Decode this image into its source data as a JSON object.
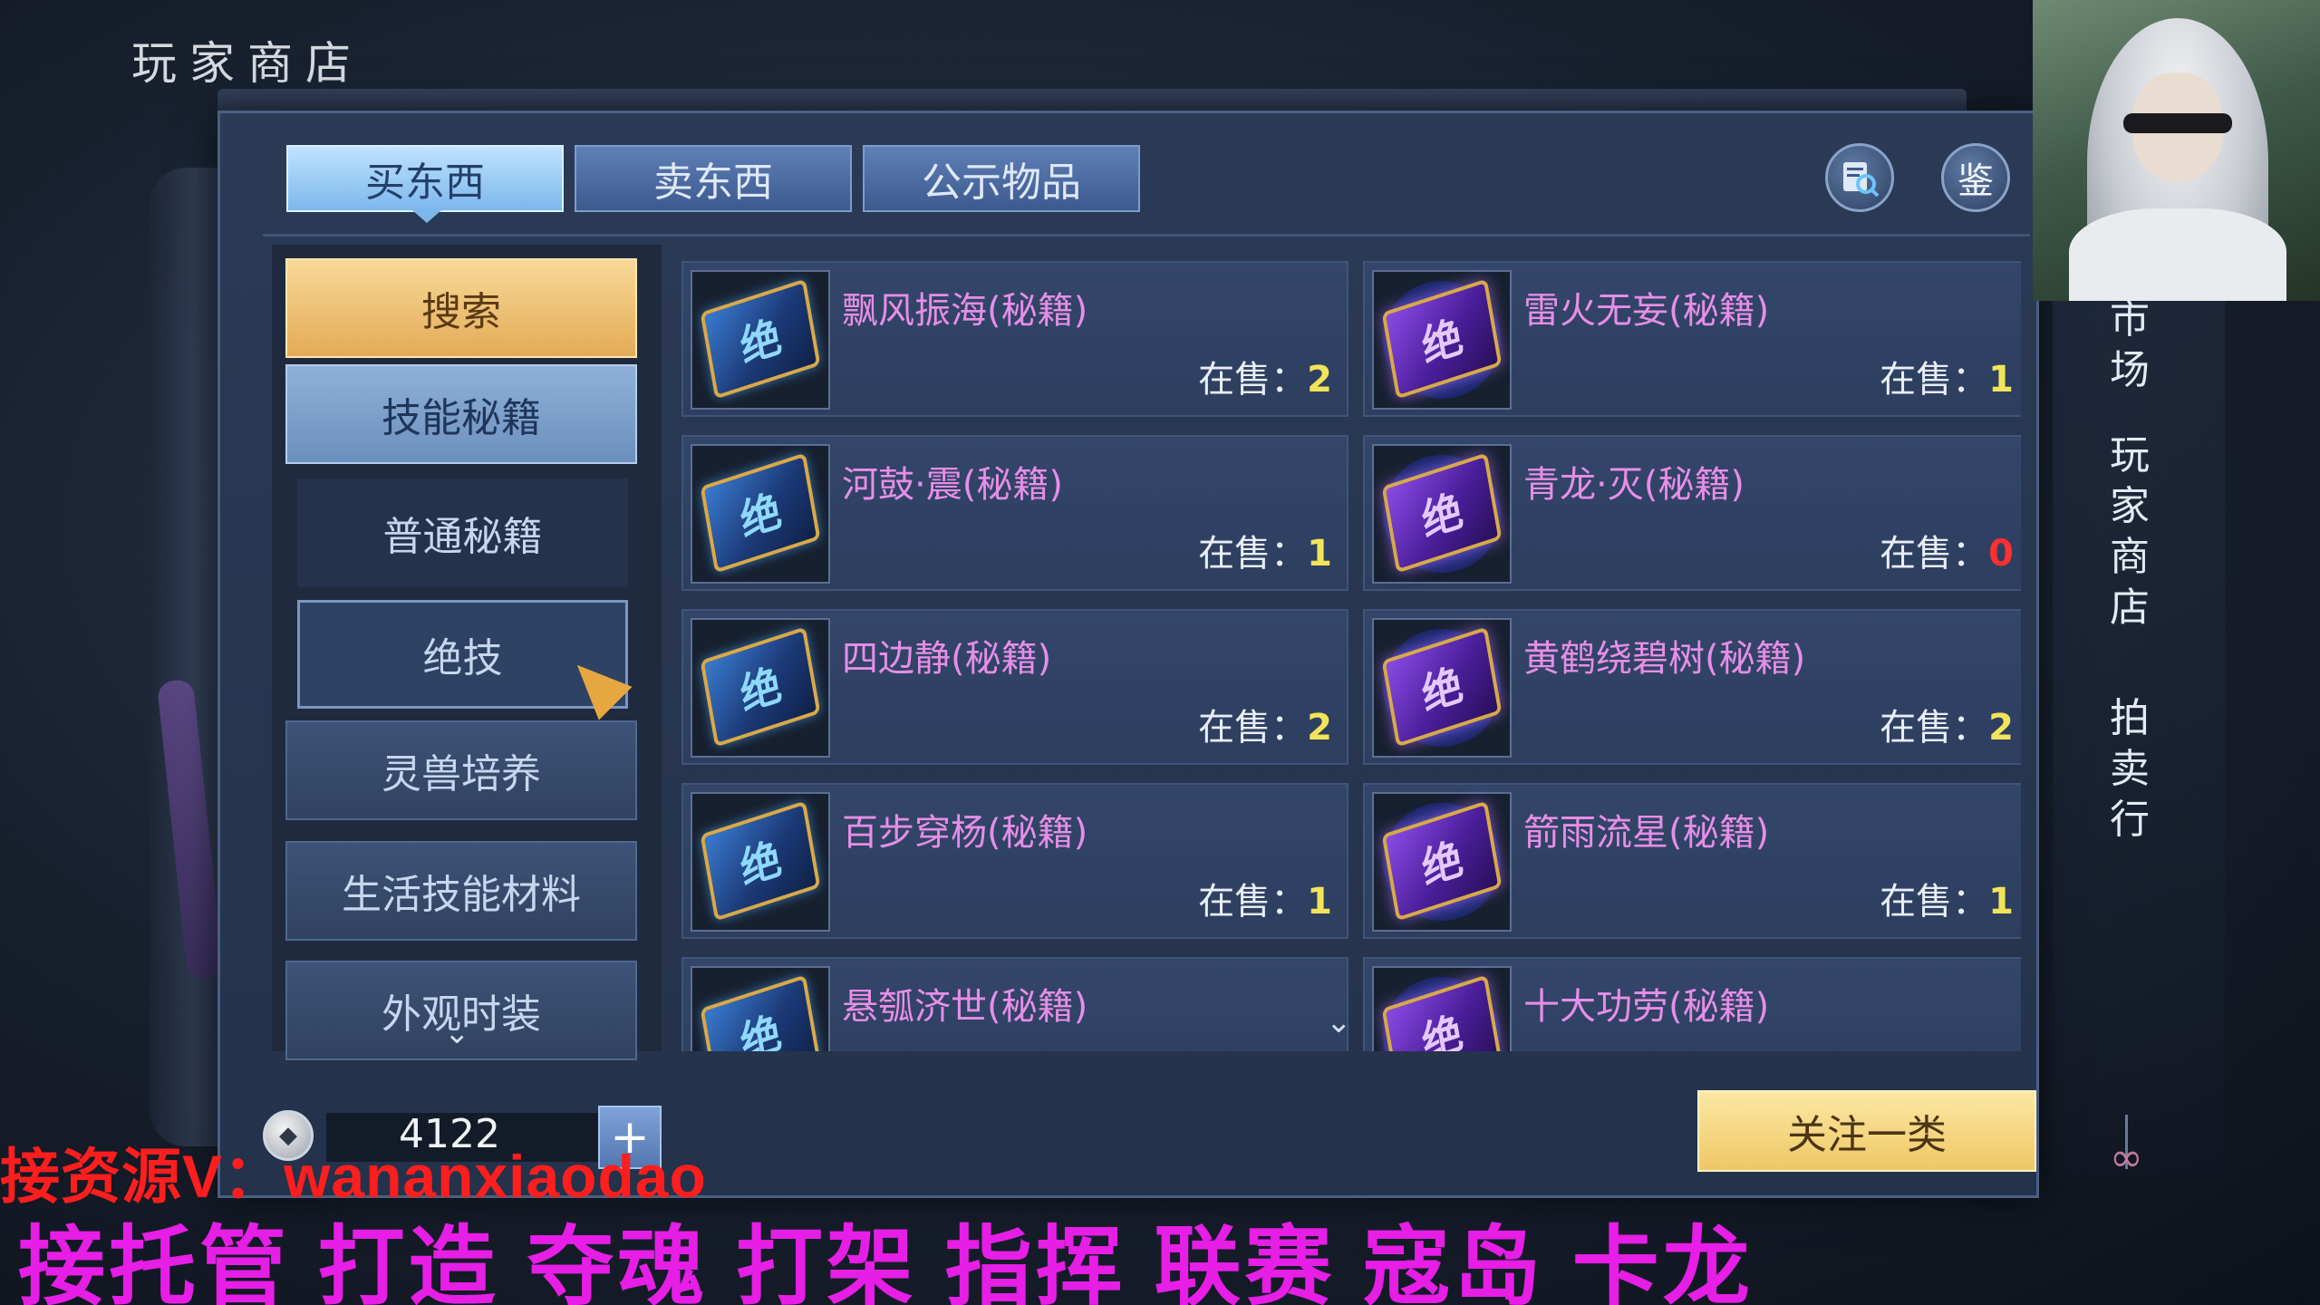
{
  "window_title": "玩家商店",
  "tabs": [
    {
      "label": "买东西",
      "active": true
    },
    {
      "label": "卖东西",
      "active": false
    },
    {
      "label": "公示物品",
      "active": false
    }
  ],
  "top_icons": {
    "catalog_icon": "catalog-search-icon",
    "appraise_label": "鉴"
  },
  "categories": {
    "search": "搜索",
    "skill_books": "技能秘籍",
    "sub": [
      "普通秘籍",
      "绝技"
    ],
    "selected_sub": "绝技",
    "others": [
      "灵兽培养",
      "生活技能材料",
      "外观时装"
    ]
  },
  "book_glyph": "绝",
  "stock_label": "在售：",
  "items": [
    {
      "name": "飘风振海(秘籍)",
      "stock": "2",
      "style": "blue"
    },
    {
      "name": "雷火无妄(秘籍)",
      "stock": "1",
      "style": "purple"
    },
    {
      "name": "河鼓·震(秘籍)",
      "stock": "1",
      "style": "blue"
    },
    {
      "name": "青龙·灭(秘籍)",
      "stock": "0",
      "style": "purple"
    },
    {
      "name": "四边静(秘籍)",
      "stock": "2",
      "style": "blue"
    },
    {
      "name": "黄鹤绕碧树(秘籍)",
      "stock": "2",
      "style": "purple"
    },
    {
      "name": "百步穿杨(秘籍)",
      "stock": "1",
      "style": "blue"
    },
    {
      "name": "箭雨流星(秘籍)",
      "stock": "1",
      "style": "purple"
    },
    {
      "name": "悬瓠济世(秘籍)",
      "stock": "",
      "style": "blue"
    },
    {
      "name": "十大功劳(秘籍)",
      "stock": "",
      "style": "purple"
    }
  ],
  "currency": {
    "amount": "4122",
    "plus": "+"
  },
  "follow_button": "关注一类",
  "right_nav": [
    {
      "chars": [
        "市",
        "场"
      ]
    },
    {
      "chars": [
        "玩",
        "家",
        "商",
        "店"
      ]
    },
    {
      "chars": [
        "拍",
        "卖",
        "行"
      ]
    }
  ],
  "overlay": {
    "line1_cn": "接资源V：",
    "line1_latin": "wananxiaodao",
    "line2": "接托管 打造 夺魂 打架 指挥 联赛 寇岛 卡龙"
  },
  "colors": {
    "item_name": "#e68ee6",
    "stock_value": "#f2e45a",
    "stock_zero": "#ff3030",
    "ad_red": "#ff1e1e",
    "ad_magenta": "#e61ee6"
  }
}
